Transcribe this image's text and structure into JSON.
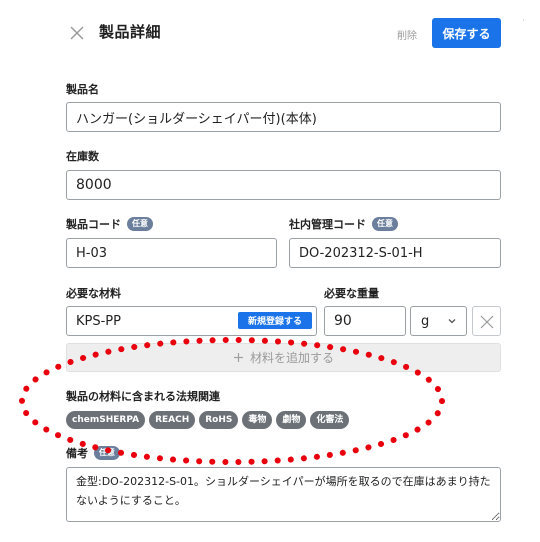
{
  "header": {
    "title": "製品詳細",
    "delete_label": "削除",
    "save_label": "保存する",
    "edge_mark": "·"
  },
  "form": {
    "product_name": {
      "label": "製品名",
      "value": "ハンガー(ショルダーシェイパー付)(本体)"
    },
    "stock": {
      "label": "在庫数",
      "value": "8000"
    },
    "product_code": {
      "label": "製品コード",
      "optional_tag": "任意",
      "value": "H-03"
    },
    "internal_code": {
      "label": "社内管理コード",
      "optional_tag": "任意",
      "value": "DO-202312-S-01-H"
    },
    "materials": {
      "label": "必要な材料",
      "value": "KPS-PP",
      "new_register_label": "新規登録する",
      "add_label": "材料を追加する"
    },
    "weight": {
      "label": "必要な重量",
      "value": "90",
      "unit": "g"
    },
    "regulations": {
      "label": "製品の材料に含まれる法規関連",
      "chips": [
        "chemSHERPA",
        "REACH",
        "RoHS",
        "毒物",
        "劇物",
        "化審法"
      ]
    },
    "notes": {
      "label": "備考",
      "optional_tag": "任意",
      "value": "金型:DO-202312-S-01。ショルダーシェイパーが場所を取るので在庫はあまり持たないようにすること。"
    }
  },
  "colors": {
    "accent": "#1a73e8",
    "tag": "#6b7f9c",
    "chip": "#6b7177",
    "annotation": "#e8000d"
  },
  "icons": {
    "close": "close-icon",
    "chevron": "chevron-down-icon",
    "remove": "close-icon",
    "add": "plus-icon"
  }
}
